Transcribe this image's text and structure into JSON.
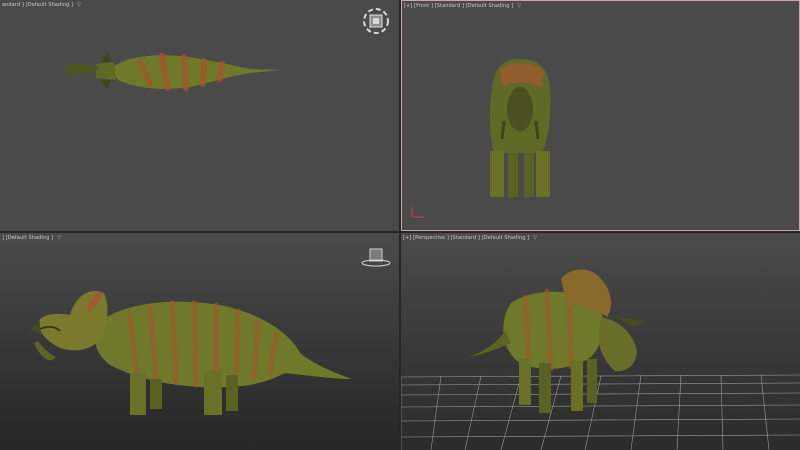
{
  "viewports": {
    "top": {
      "label": "andard ] [Default Shading ]",
      "filter_glyph": "▽"
    },
    "front": {
      "label": "[+] [Front ] [Standard ] [Default Shading ]",
      "filter_glyph": "▽"
    },
    "left": {
      "label": "] [Default Shading ]",
      "filter_glyph": "▽"
    },
    "perspective": {
      "label": "[+] [Perspective ] [Standard ] [Default Shading ]",
      "filter_glyph": "▽"
    }
  },
  "colors": {
    "viewport_bg": "#4a4a4a",
    "active_border": "#c9a7a7",
    "dino_body": "#6e7a2a",
    "dino_stripe": "#a8542c",
    "grid": "#9a9a9a"
  },
  "icons": [
    "viewcube-icon",
    "viewcube-icon",
    "axis-gizmo-icon",
    "filter-icon"
  ]
}
